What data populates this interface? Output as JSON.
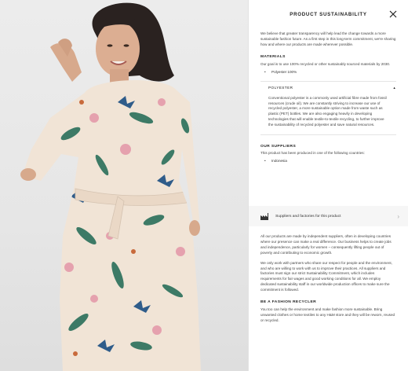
{
  "panel": {
    "title": "PRODUCT SUSTAINABILITY",
    "intro": "We believe that greater transparency will help lead the change towards a more sustainable fashion future. As a first step in this long-term commitment, we're sharing how and where our products are made wherever possible.",
    "materials": {
      "heading": "MATERIALS",
      "text": "Our goal is to use 100% recycled or other sustainably sourced materials by 2030.",
      "items": [
        "Polyester 100%"
      ]
    },
    "polyester": {
      "heading": "POLYESTER",
      "chevron": "chevron-up-icon",
      "text": "Conventional polyester is a commonly used artificial fibre made from fossil resources (crude oil). We are constantly striving to increase our use of recycled polyester, a more sustainable option made from waste such as plastic (PET) bottles. We are also engaging heavily in developing technologies that will enable textile-to-textile recycling, to further improve the sustainability of recycled polyester and save natural resources."
    },
    "suppliers": {
      "heading": "OUR SUPPLIERS",
      "text": "This product has been produced in one of the following countries:",
      "items": [
        "Indonesia"
      ]
    },
    "suppliers_link": {
      "label": "Suppliers and factories for this product",
      "icon": "factory-icon",
      "arrow": "›"
    },
    "independent": {
      "p1": "All our products are made by independent suppliers, often in developing countries where our presence can make a real difference. Our business helps to create jobs and independence, particularly for women – consequently lifting people out of poverty and contributing to economic growth.",
      "p2": "We only work with partners who share our respect for people and the environment, and who are willing to work with us to improve their practices. All suppliers and factories must sign our strict Sustainability Commitment, which includes requirements for fair wages and good working conditions for all. We employ dedicated sustainability staff in our worldwide production offices to make sure the commitment is followed."
    },
    "recycler": {
      "heading": "BE A FASHION RECYCLER",
      "text": "You too can help the environment and make fashion more sustainable. Bring unwanted clothes or home textiles to any H&M store and they will be reworn, reused or recycled."
    }
  },
  "colors": {
    "dress_base": "#f1e4d6",
    "background": "#ececec",
    "panel_bg": "#ffffff",
    "link_row_bg": "#f6f6f6"
  }
}
